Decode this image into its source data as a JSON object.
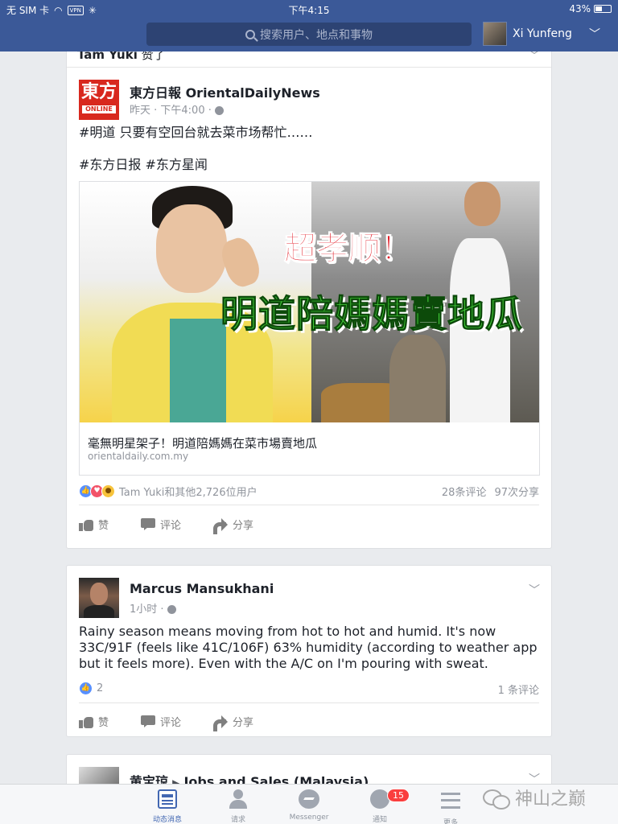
{
  "status_bar": {
    "carrier": "无 SIM 卡",
    "vpn": "VPN",
    "time": "下午4:15",
    "battery": "43%",
    "battery_level": 0.43
  },
  "nav": {
    "search_placeholder": "搜索用户、地点和事物",
    "user_name": "Xi Yunfeng",
    "menu_chevron": "﹀"
  },
  "posts": [
    {
      "liked_by_name": "Tam Yuki",
      "liked_by_verb": " 赞了",
      "author": "東方日報 OrientalDailyNews",
      "logo_main": "東方",
      "logo_sub": "ONLINE",
      "meta": "昨天 · 下午4:00 ·",
      "text_line1": "#明道 只要有空回台就去菜市场帮忙……",
      "text_line2": "#东方日报 #东方星闻",
      "image_headline_red": "超孝顺！",
      "image_headline_green": "明道陪媽媽賣地瓜",
      "link_title": "毫無明星架子！明道陪媽媽在菜市場賣地瓜",
      "link_domain": "orientaldaily.com.my",
      "reactions_text": "Tam Yuki和其他2,726位用户",
      "comments": "28条评论",
      "shares": "97次分享"
    },
    {
      "author": "Marcus Mansukhani",
      "meta": "1小时 ·",
      "text": "Rainy season means moving from hot to hot and humid. It's now 33C/91F (feels like 41C/106F) 63% humidity (according to weather app but it feels more). Even with the A/C on I'm pouring with sweat.",
      "likes": "2",
      "comments": "1 条评论"
    },
    {
      "author": "黄宝琼",
      "arrow": "▶",
      "group": "Jobs and Sales (Malaysia)"
    }
  ],
  "actions": {
    "like": "赞",
    "comment": "评论",
    "share": "分享"
  },
  "tabbar": {
    "items": [
      {
        "label": "动态消息",
        "icon": "news-feed-icon"
      },
      {
        "label": "请求",
        "icon": "friend-requests-icon"
      },
      {
        "label": "Messenger",
        "icon": "messenger-icon"
      },
      {
        "label": "通知",
        "icon": "notifications-globe-icon"
      },
      {
        "label": "更多",
        "icon": "more-menu-icon"
      }
    ],
    "notification_badge": "15"
  },
  "watermark": "神山之巅",
  "colors": {
    "brand": "#3b5998",
    "tab_active": "#4267b2",
    "badge": "#fa3e3e"
  }
}
